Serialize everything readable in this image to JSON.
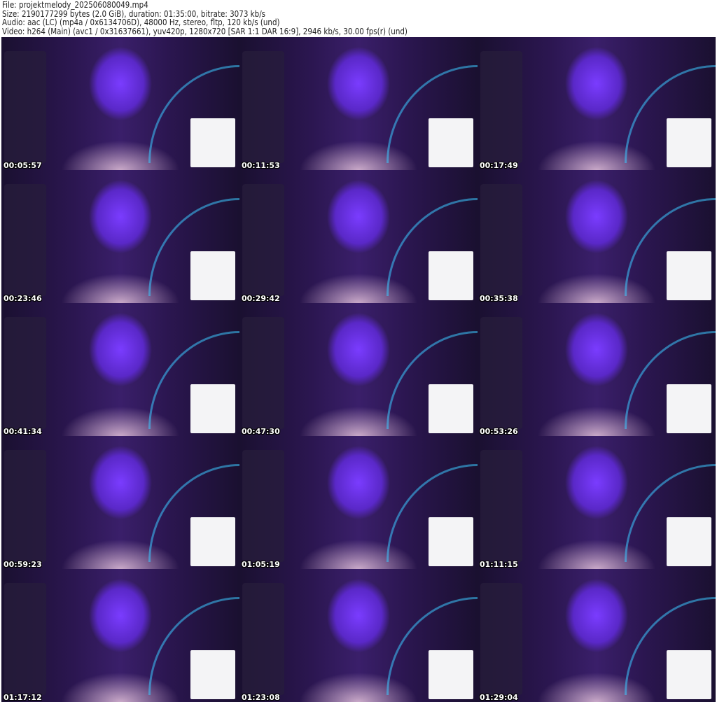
{
  "header": {
    "file": "File: projektmelody_202506080049.mp4",
    "size": "Size: 2190177299 bytes (2.0 GiB), duration: 01:35:00, bitrate: 3073 kb/s",
    "audio": "Audio: aac (LC) (mp4a / 0x6134706D), 48000 Hz, stereo, fltp, 120 kb/s (und)",
    "video": "Video: h264 (Main) (avc1 / 0x31637661), yuv420p, 1280x720 [SAR 1:1 DAR 16:9], 2946 kb/s, 30.00 fps(r) (und)"
  },
  "thumbnails": [
    {
      "timestamp": "00:05:57"
    },
    {
      "timestamp": "00:11:53"
    },
    {
      "timestamp": "00:17:49"
    },
    {
      "timestamp": "00:23:46"
    },
    {
      "timestamp": "00:29:42"
    },
    {
      "timestamp": "00:35:38"
    },
    {
      "timestamp": "00:41:34"
    },
    {
      "timestamp": "00:47:30"
    },
    {
      "timestamp": "00:53:26"
    },
    {
      "timestamp": "00:59:23"
    },
    {
      "timestamp": "01:05:19"
    },
    {
      "timestamp": "01:11:15"
    },
    {
      "timestamp": "01:17:12"
    },
    {
      "timestamp": "01:23:08"
    },
    {
      "timestamp": "01:29:04"
    }
  ]
}
